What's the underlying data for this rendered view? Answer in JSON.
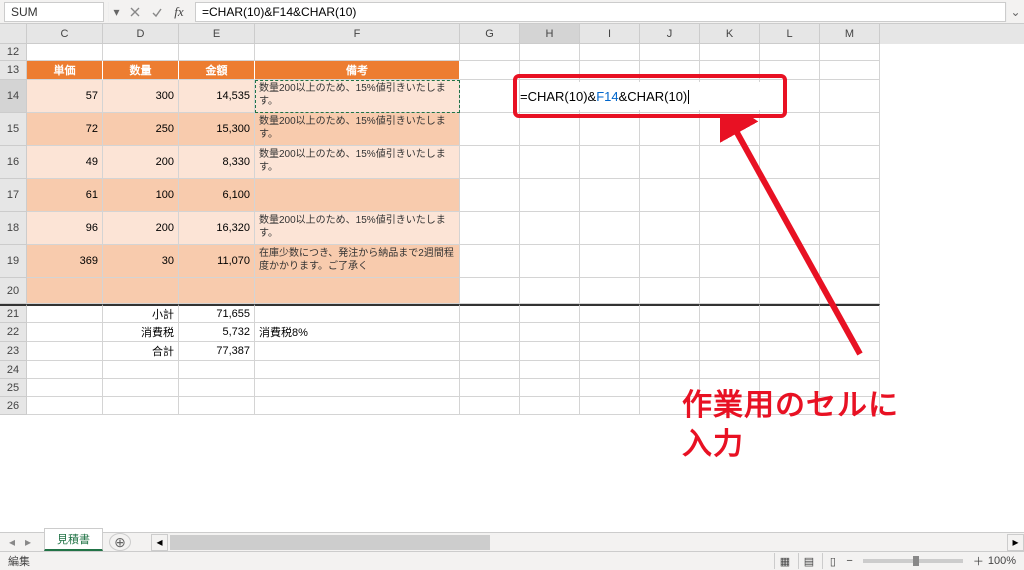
{
  "name_box": "SUM",
  "formula_bar": "=CHAR(10)&F14&CHAR(10)",
  "columns": [
    "C",
    "D",
    "E",
    "F",
    "G",
    "H",
    "I",
    "J",
    "K",
    "L",
    "M"
  ],
  "rows_shown": [
    "12",
    "13",
    "14",
    "15",
    "16",
    "17",
    "18",
    "19",
    "20",
    "21",
    "22",
    "23",
    "24",
    "25",
    "26"
  ],
  "headers": {
    "C": "単価",
    "D": "数量",
    "E": "金額",
    "F": "備考"
  },
  "data_rows": [
    {
      "r": "14",
      "C": "57",
      "D": "300",
      "E": "14,535",
      "F": "数量200以上のため、15%値引きいたします。"
    },
    {
      "r": "15",
      "C": "72",
      "D": "250",
      "E": "15,300",
      "F": "数量200以上のため、15%値引きいたします。"
    },
    {
      "r": "16",
      "C": "49",
      "D": "200",
      "E": "8,330",
      "F": "数量200以上のため、15%値引きいたします。"
    },
    {
      "r": "17",
      "C": "61",
      "D": "100",
      "E": "6,100",
      "F": ""
    },
    {
      "r": "18",
      "C": "96",
      "D": "200",
      "E": "16,320",
      "F": "数量200以上のため、15%値引きいたします。"
    },
    {
      "r": "19",
      "C": "369",
      "D": "30",
      "E": "11,070",
      "F": "在庫少数につき、発注から納品まで2週間程度かかります。ご了承く"
    }
  ],
  "totals": {
    "subtotal": {
      "label": "小計",
      "value": "71,655"
    },
    "tax": {
      "label": "消費税",
      "value": "5,732",
      "note": "消費税8%"
    },
    "grand": {
      "label": "合計",
      "value": "77,387"
    }
  },
  "editing": {
    "parts": [
      {
        "t": "=CHAR(10)&",
        "c": "black"
      },
      {
        "t": "F14",
        "c": "ref-blue"
      },
      {
        "t": "&CHAR(10)",
        "c": "black"
      }
    ]
  },
  "annotation": {
    "line1": "作業用のセルに",
    "line2": "入力"
  },
  "sheet_tab": "見積書",
  "status": "編集",
  "zoom": "100%"
}
